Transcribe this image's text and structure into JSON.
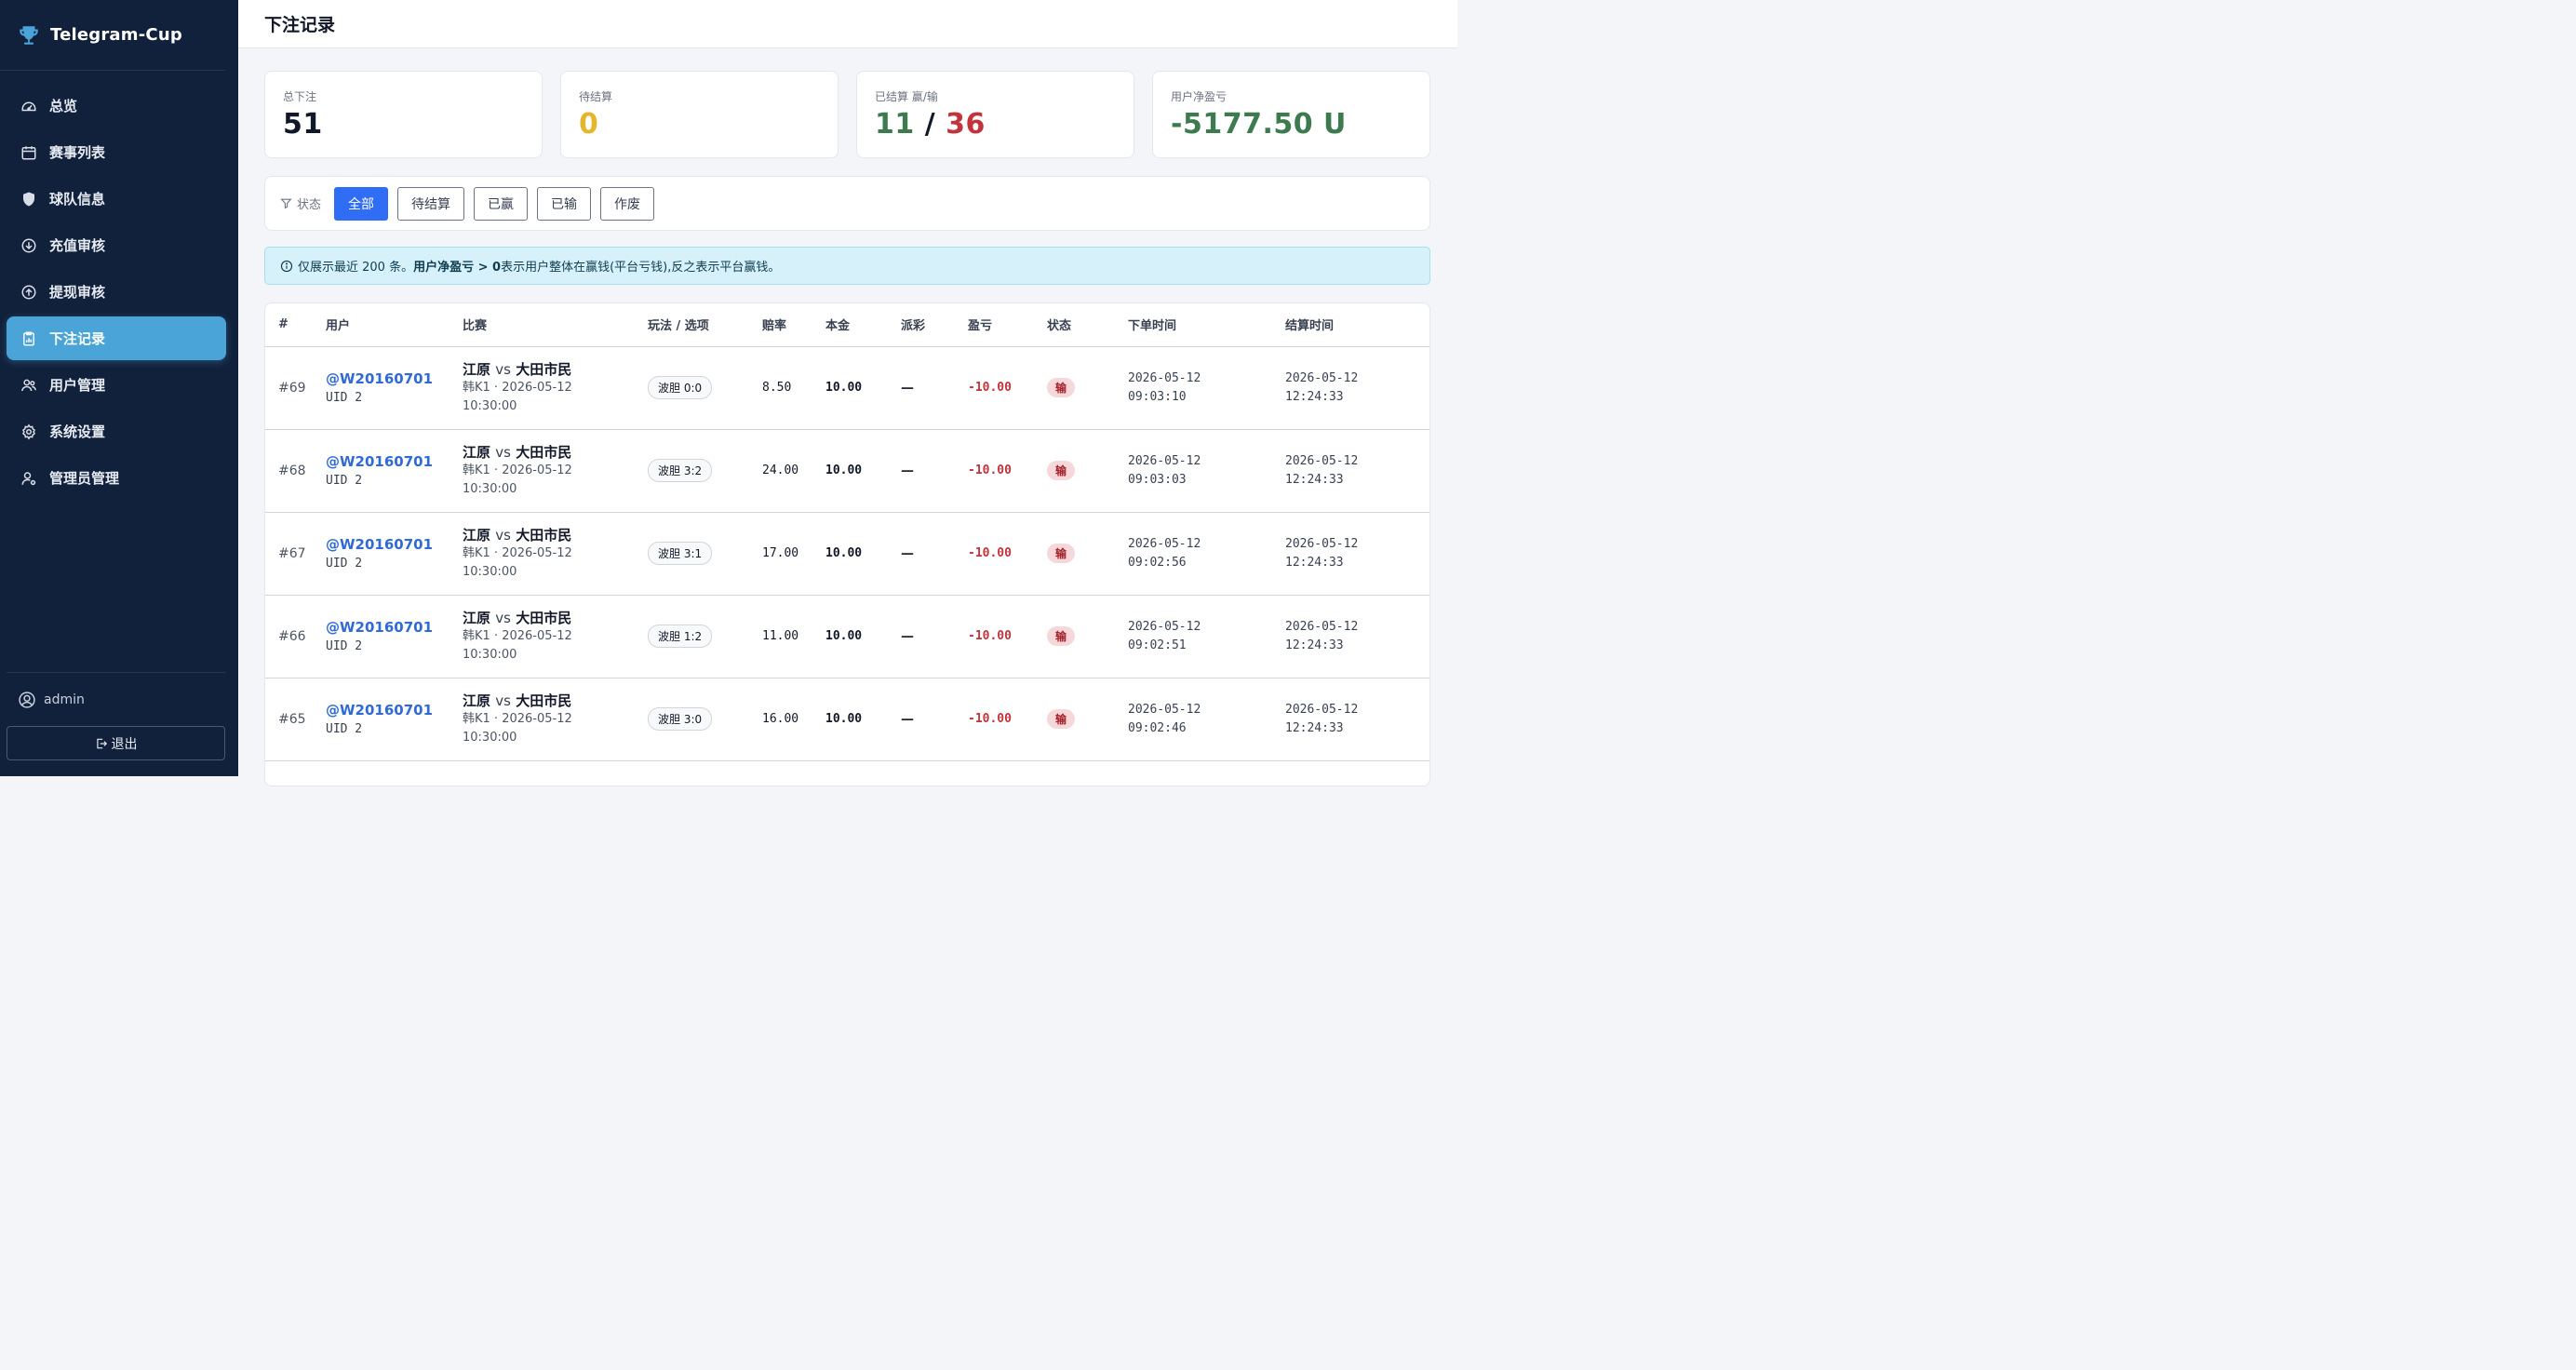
{
  "app": {
    "name": "Telegram-Cup"
  },
  "sidebar": {
    "items": [
      {
        "label": "总览",
        "icon": "gauge-icon"
      },
      {
        "label": "赛事列表",
        "icon": "calendar-icon"
      },
      {
        "label": "球队信息",
        "icon": "shield-icon"
      },
      {
        "label": "充值审核",
        "icon": "arrow-down-circle-icon"
      },
      {
        "label": "提现审核",
        "icon": "arrow-up-circle-icon"
      },
      {
        "label": "下注记录",
        "icon": "clipboard-chart-icon",
        "active": true
      },
      {
        "label": "用户管理",
        "icon": "users-icon"
      },
      {
        "label": "系统设置",
        "icon": "gear-icon"
      },
      {
        "label": "管理员管理",
        "icon": "admin-user-icon"
      }
    ],
    "user": "admin",
    "logout": "退出"
  },
  "page": {
    "title": "下注记录"
  },
  "stats": {
    "total_label": "总下注",
    "total_value": "51",
    "pending_label": "待结算",
    "pending_value": "0",
    "settled_label": "已结算 赢/输",
    "settled_win": "11",
    "settled_sep": "/",
    "settled_loss": "36",
    "pnl_label": "用户净盈亏",
    "pnl_value": "-5177.50 U"
  },
  "filter": {
    "label": "状态",
    "options": [
      "全部",
      "待结算",
      "已赢",
      "已输",
      "作废"
    ],
    "active": "全部"
  },
  "notice": {
    "prefix": "仅展示最近 200 条。",
    "bold": "用户净盈亏 > 0",
    "suffix": " 表示用户整体在赢钱(平台亏钱),反之表示平台赢钱。"
  },
  "table": {
    "headers": [
      "#",
      "用户",
      "比赛",
      "玩法 / 选项",
      "赔率",
      "本金",
      "派彩",
      "盈亏",
      "状态",
      "下单时间",
      "结算时间"
    ],
    "rows": [
      {
        "id": "#69",
        "user": "@W20160701",
        "uid": "UID 2",
        "home": "江原",
        "vs": "vs",
        "away": "大田市民",
        "league": "韩K1 · 2026-05-12",
        "kickoff": "10:30:00",
        "pick": "波胆 0:0",
        "odds": "8.50",
        "stake": "10.00",
        "payout": "—",
        "pnl": "-10.00",
        "status": "输",
        "placed_date": "2026-05-12",
        "placed_time": "09:03:10",
        "settled_date": "2026-05-12",
        "settled_time": "12:24:33"
      },
      {
        "id": "#68",
        "user": "@W20160701",
        "uid": "UID 2",
        "home": "江原",
        "vs": "vs",
        "away": "大田市民",
        "league": "韩K1 · 2026-05-12",
        "kickoff": "10:30:00",
        "pick": "波胆 3:2",
        "odds": "24.00",
        "stake": "10.00",
        "payout": "—",
        "pnl": "-10.00",
        "status": "输",
        "placed_date": "2026-05-12",
        "placed_time": "09:03:03",
        "settled_date": "2026-05-12",
        "settled_time": "12:24:33"
      },
      {
        "id": "#67",
        "user": "@W20160701",
        "uid": "UID 2",
        "home": "江原",
        "vs": "vs",
        "away": "大田市民",
        "league": "韩K1 · 2026-05-12",
        "kickoff": "10:30:00",
        "pick": "波胆 3:1",
        "odds": "17.00",
        "stake": "10.00",
        "payout": "—",
        "pnl": "-10.00",
        "status": "输",
        "placed_date": "2026-05-12",
        "placed_time": "09:02:56",
        "settled_date": "2026-05-12",
        "settled_time": "12:24:33"
      },
      {
        "id": "#66",
        "user": "@W20160701",
        "uid": "UID 2",
        "home": "江原",
        "vs": "vs",
        "away": "大田市民",
        "league": "韩K1 · 2026-05-12",
        "kickoff": "10:30:00",
        "pick": "波胆 1:2",
        "odds": "11.00",
        "stake": "10.00",
        "payout": "—",
        "pnl": "-10.00",
        "status": "输",
        "placed_date": "2026-05-12",
        "placed_time": "09:02:51",
        "settled_date": "2026-05-12",
        "settled_time": "12:24:33"
      },
      {
        "id": "#65",
        "user": "@W20160701",
        "uid": "UID 2",
        "home": "江原",
        "vs": "vs",
        "away": "大田市民",
        "league": "韩K1 · 2026-05-12",
        "kickoff": "10:30:00",
        "pick": "波胆 3:0",
        "odds": "16.00",
        "stake": "10.00",
        "payout": "—",
        "pnl": "-10.00",
        "status": "输",
        "placed_date": "2026-05-12",
        "placed_time": "09:02:46",
        "settled_date": "2026-05-12",
        "settled_time": "12:24:33"
      }
    ]
  },
  "colors": {
    "sidebar_bg": "#12213b",
    "active_nav": "#4aa4d8",
    "primary": "#2f6df5",
    "pending": "#e5b52a",
    "win": "#3d7a4e",
    "loss": "#c2343b"
  }
}
